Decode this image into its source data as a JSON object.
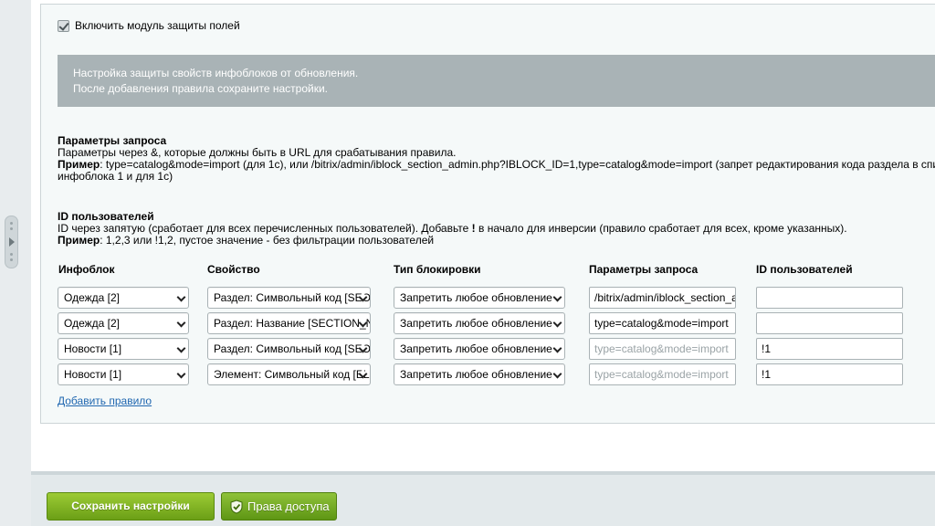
{
  "module_toggle": {
    "label": "Включить модуль защиты полей",
    "checked": true
  },
  "note": {
    "line1": "Настройка защиты свойств инфоблоков от обновления.",
    "line2": "После добавления правила сохраните настройки."
  },
  "request_params": {
    "title": "Параметры запроса",
    "desc": "Параметры через &, которые должны быть в URL для срабатывания правила.",
    "example_label": "Пример",
    "example_line1": ": type=catalog&mode=import (для 1с), или /bitrix/admin/iblock_section_admin.php?IBLOCK_ID=1,type=catalog&mode=import (запрет редактирования кода раздела в списке д",
    "example_line2": "инфоблока 1 и для 1с)"
  },
  "user_ids": {
    "title": "ID пользователей",
    "desc_pre": "ID через запятую (сработает для всех перечисленных пользователей). Добавьте ",
    "desc_bang": "!",
    "desc_post": " в начало для инверсии (правило сработает для всех, кроме указанных).",
    "example_label": "Пример",
    "example_text": ": 1,2,3 или !1,2, пустое значение - без фильтрации пользователей"
  },
  "columns": {
    "iblock": "Инфоблок",
    "property": "Свойство",
    "lock_type": "Тип блокировки",
    "params": "Параметры запроса",
    "users": "ID пользователей"
  },
  "rules": [
    {
      "iblock": "Одежда [2]",
      "property": "Раздел: Символьный код [SEO",
      "lock": "Запретить любое обновление",
      "params": "/bitrix/admin/iblock_section_a",
      "params_placeholder": false,
      "users": ""
    },
    {
      "iblock": "Одежда [2]",
      "property": "Раздел: Название [SECTION_N",
      "lock": "Запретить любое обновление",
      "params": "type=catalog&mode=import",
      "params_placeholder": false,
      "users": ""
    },
    {
      "iblock": "Новости [1]",
      "property": "Раздел: Символьный код [SEO",
      "lock": "Запретить любое обновление",
      "params": "type=catalog&mode=import",
      "params_placeholder": true,
      "users": "!1"
    },
    {
      "iblock": "Новости [1]",
      "property": "Элемент: Символьный код [EL",
      "lock": "Запретить любое обновление",
      "params": "type=catalog&mode=import",
      "params_placeholder": true,
      "users": "!1"
    }
  ],
  "add_rule_link": "Добавить правило",
  "footer": {
    "save_label": "Сохранить настройки",
    "access_label": "Права доступа"
  },
  "icons": {
    "collapse": "chevron-right-icon",
    "access": "shield-check-icon",
    "checkbox": "checkmark-icon"
  },
  "colors": {
    "accent_green": "#6b9f16",
    "link_blue": "#2067b0",
    "note_bg": "#a9b3b6"
  }
}
